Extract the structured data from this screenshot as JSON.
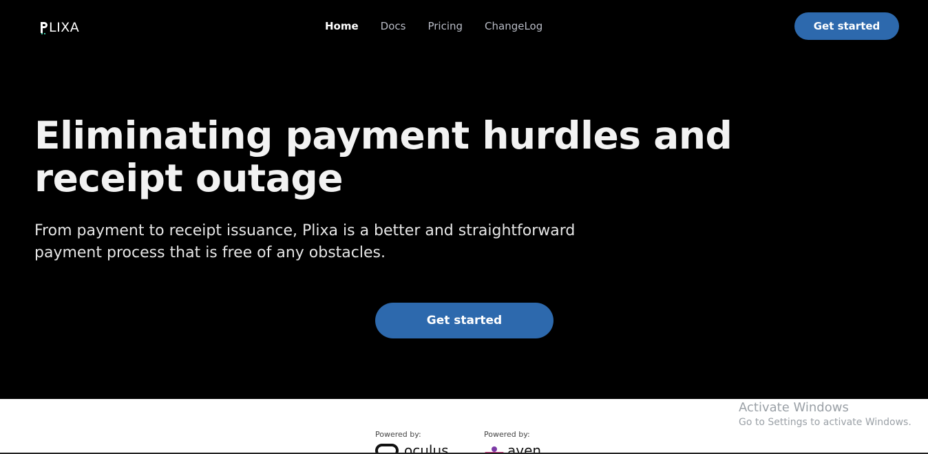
{
  "header": {
    "logo_text": "LIXA",
    "nav": [
      {
        "label": "Home"
      },
      {
        "label": "Docs"
      },
      {
        "label": "Pricing"
      },
      {
        "label": "ChangeLog"
      }
    ],
    "cta_label": "Get started"
  },
  "hero": {
    "headline": "Eliminating payment hurdles and receipt outage",
    "subtitle": "From payment to receipt issuance, Plixa is a better and straightforward payment process that is free of any obstacles.",
    "cta_label": "Get started"
  },
  "partners": [
    {
      "powered_by": "Powered by:",
      "name": "oculus"
    },
    {
      "powered_by": "Powered by:",
      "name": "aven"
    }
  ],
  "watermark": {
    "title": "Activate Windows",
    "subtitle": "Go to Settings to activate Windows."
  },
  "colors": {
    "accent": "#2d69ad",
    "background": "#000000",
    "band": "#ffffff"
  }
}
